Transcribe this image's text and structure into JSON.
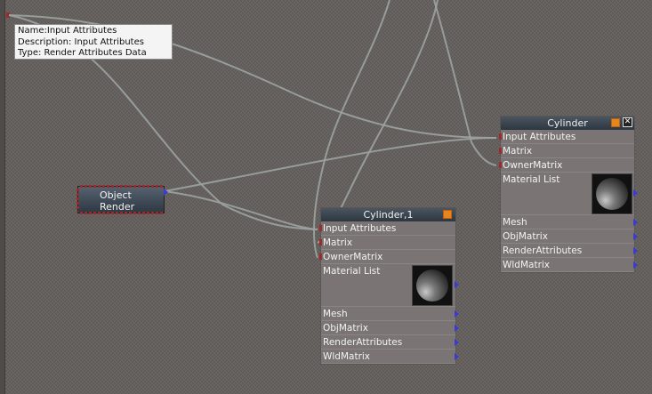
{
  "tooltip": {
    "name_line": "Name:Input Attributes",
    "description_line": "Description: Input Attributes",
    "type_line": "Type: Render Attributes Data"
  },
  "object_render_node": {
    "line1": "Object",
    "line2": "Render"
  },
  "cylinder_node": {
    "title": "Cylinder",
    "inputs": [
      "Input Attributes",
      "Matrix",
      "OwnerMatrix"
    ],
    "material_label": "Material List",
    "outputs": [
      "Mesh",
      "ObjMatrix",
      "RenderAttributes",
      "WldMatrix"
    ]
  },
  "cylinder1_node": {
    "title": "Cylinder,1",
    "inputs": [
      "Input Attributes",
      "Matrix",
      "OwnerMatrix"
    ],
    "material_label": "Material List",
    "outputs": [
      "Mesh",
      "ObjMatrix",
      "RenderAttributes",
      "WldMatrix"
    ]
  },
  "colors": {
    "wire": "#9ca3a0",
    "input_pin": "#9c2a2a",
    "output_pin": "#3a3ad8",
    "header_button": "#e8851c"
  }
}
